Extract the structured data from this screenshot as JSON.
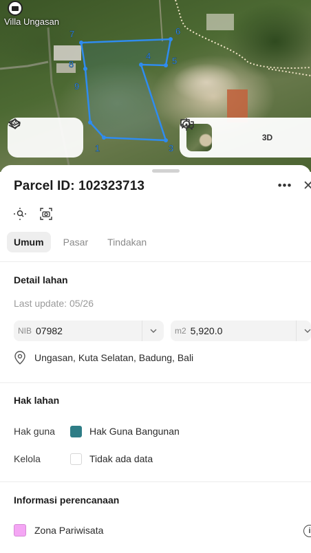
{
  "map": {
    "place_label": "Villa Ungasan",
    "vertex_labels": [
      "1",
      "3",
      "4",
      "5",
      "6",
      "7",
      "8",
      "9"
    ],
    "parcel_color": "#2f8cf0",
    "controls": {
      "three_d_label": "3D"
    }
  },
  "header": {
    "title": "Parcel ID: 102323713",
    "more_label": "•••",
    "close_label": "✕"
  },
  "tabs": [
    {
      "label": "Umum",
      "active": true
    },
    {
      "label": "Pasar",
      "active": false
    },
    {
      "label": "Tindakan",
      "active": false
    }
  ],
  "detail_lahan": {
    "title": "Detail lahan",
    "last_update": "Last update: 05/26",
    "nib_prefix": "NIB",
    "nib_value": "07982",
    "area_prefix": "m2",
    "area_value": "5,920.0",
    "location": "Ungasan, Kuta Selatan, Badung, Bali"
  },
  "hak_lahan": {
    "title": "Hak lahan",
    "rows": [
      {
        "label": "Hak guna",
        "value": "Hak Guna Bangunan",
        "swatch": "#2e7d86"
      },
      {
        "label": "Kelola",
        "value": "Tidak ada data",
        "swatch": "#ffffff"
      }
    ]
  },
  "perencanaan": {
    "title": "Informasi perencanaan",
    "zone_label": "Zona Pariwisata",
    "zone_color": "#f4a6f4",
    "info_label": "i"
  }
}
